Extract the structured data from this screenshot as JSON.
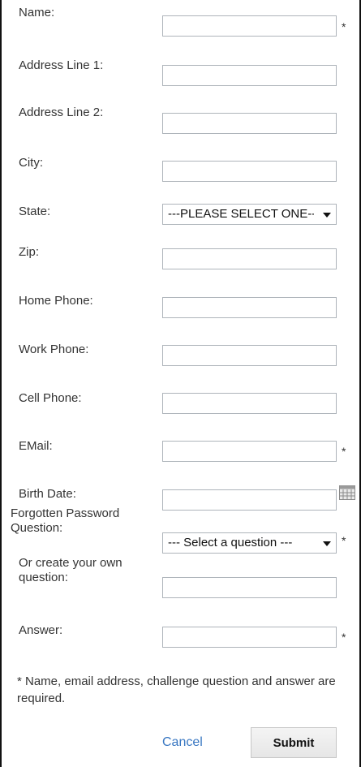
{
  "form": {
    "fields": {
      "name": {
        "label": "Name:",
        "value": "",
        "required": true
      },
      "address1": {
        "label": "Address Line 1:",
        "value": ""
      },
      "address2": {
        "label": "Address Line 2:",
        "value": ""
      },
      "city": {
        "label": "City:",
        "value": ""
      },
      "state": {
        "label": "State:",
        "selected": "---PLEASE SELECT ONE---"
      },
      "zip": {
        "label": "Zip:",
        "value": ""
      },
      "home_phone": {
        "label": "Home Phone:",
        "value": ""
      },
      "work_phone": {
        "label": "Work Phone:",
        "value": ""
      },
      "cell_phone": {
        "label": "Cell Phone:",
        "value": ""
      },
      "email": {
        "label": "EMail:",
        "value": "",
        "required": true
      },
      "birth_date": {
        "label": "Birth Date:",
        "value": ""
      },
      "forgotten_question": {
        "label_line1": "Forgotten Password",
        "label_line2": "Question:",
        "selected": "--- Select a question ---",
        "required": true
      },
      "own_question": {
        "label_line1": "Or create your own",
        "label_line2": "question:",
        "value": ""
      },
      "answer": {
        "label": "Answer:",
        "value": "",
        "required": true
      }
    },
    "required_marker": "*",
    "note": "* Name, email address, challenge question and answer are required.",
    "cancel_label": "Cancel",
    "submit_label": "Submit"
  },
  "colors": {
    "link": "#3a78c2",
    "border": "#aeb4ba"
  },
  "icons": {
    "calendar": "calendar-icon",
    "dropdown": "chevron-down-icon"
  }
}
